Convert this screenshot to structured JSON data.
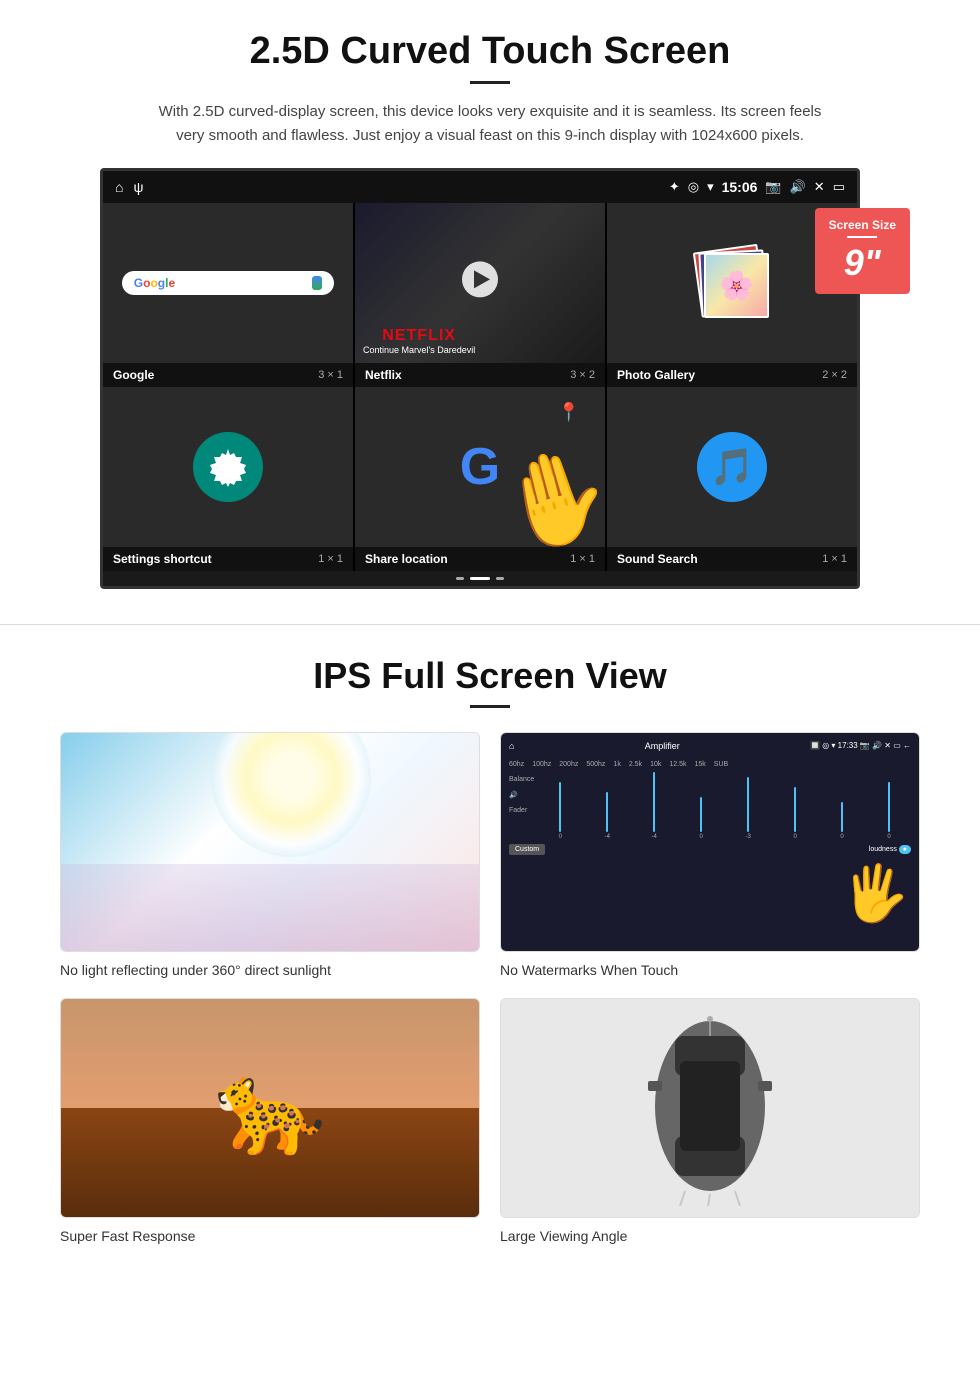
{
  "section1": {
    "title": "2.5D Curved Touch Screen",
    "description": "With 2.5D curved-display screen, this device looks very exquisite and it is seamless. Its screen feels very smooth and flawless. Just enjoy a visual feast on this 9-inch display with 1024x600 pixels.",
    "badge": {
      "label": "Screen Size",
      "size": "9\""
    },
    "statusBar": {
      "time": "15:06"
    },
    "apps": [
      {
        "name": "Google",
        "size": "3 × 1"
      },
      {
        "name": "Netflix",
        "size": "3 × 2",
        "subtitle": "Continue Marvel's Daredevil"
      },
      {
        "name": "Photo Gallery",
        "size": "2 × 2"
      },
      {
        "name": "Settings shortcut",
        "size": "1 × 1"
      },
      {
        "name": "Share location",
        "size": "1 × 1"
      },
      {
        "name": "Sound Search",
        "size": "1 × 1"
      }
    ]
  },
  "section2": {
    "title": "IPS Full Screen View",
    "features": [
      {
        "id": "sunlight",
        "label": "No light reflecting under 360° direct sunlight"
      },
      {
        "id": "amplifier",
        "label": "No Watermarks When Touch"
      },
      {
        "id": "cheetah",
        "label": "Super Fast Response"
      },
      {
        "id": "car",
        "label": "Large Viewing Angle"
      }
    ]
  }
}
